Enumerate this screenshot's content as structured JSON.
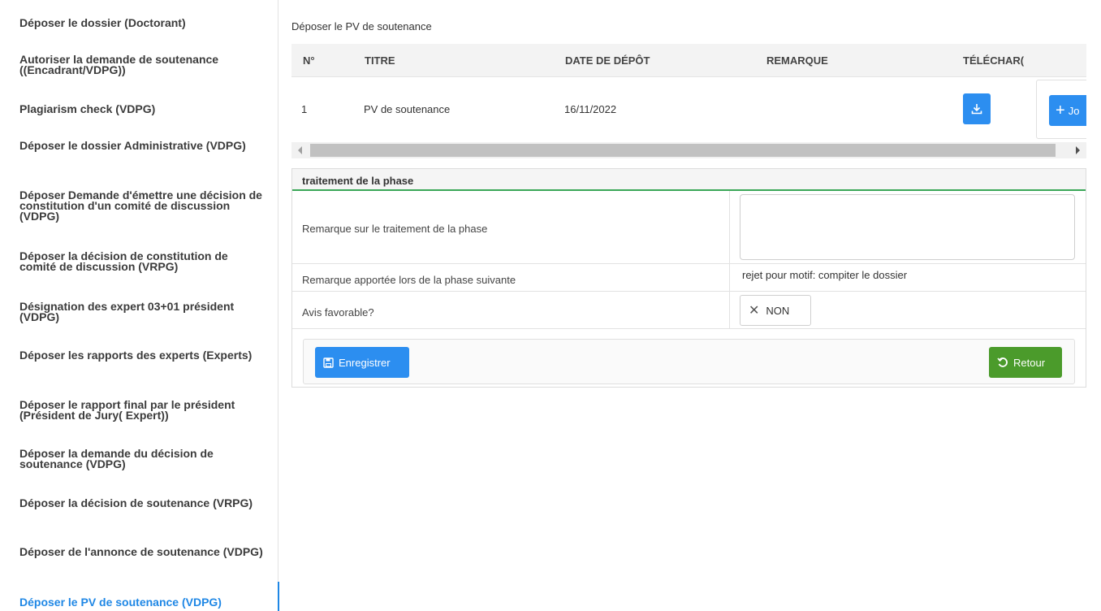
{
  "sidebar": {
    "items": [
      {
        "label": "Déposer le dossier (Doctorant)"
      },
      {
        "label": "Autoriser la demande de soutenance ((Encadrant/VDPG))"
      },
      {
        "label": "Plagiarism check (VDPG)"
      },
      {
        "label": "Déposer le dossier Administrative (VDPG)"
      },
      {
        "label": "Déposer Demande d'émettre une décision de constitution d'un comité de discussion (VDPG)"
      },
      {
        "label": "Déposer la décision de constitution de comité de discussion (VRPG)"
      },
      {
        "label": "Désignation des expert 03+01 président (VDPG)"
      },
      {
        "label": "Déposer les rapports des experts (Experts)"
      },
      {
        "label": "Déposer le rapport final par le président (Président de Jury( Expert))"
      },
      {
        "label": "Déposer la demande du décision de soutenance (VDPG)"
      },
      {
        "label": "Déposer la décision de soutenance (VRPG)"
      },
      {
        "label": "Déposer de l'annonce de soutenance (VDPG)"
      },
      {
        "label": "Déposer le PV de soutenance (VDPG)"
      }
    ],
    "active_index": 12
  },
  "main": {
    "title": "Déposer le PV de soutenance",
    "table": {
      "headers": [
        "N°",
        "TITRE",
        "DATE DE DÉPÔT",
        "REMARQUE",
        "TÉLÉCHAR("
      ],
      "rows": [
        {
          "num": "1",
          "titre": "PV de soutenance",
          "date": "16/11/2022",
          "remarque": ""
        }
      ],
      "join_label": "Jo"
    },
    "panel": {
      "title": "traitement de la phase",
      "row1_label": "Remarque sur le traitement de la phase",
      "row2_label": "Remarque apportée lors de la phase suivante",
      "row2_value": "rejet pour motif: compiter le dossier",
      "row3_label": "Avis favorable?",
      "toggle_label": "NON",
      "save_label": "Enregistrer",
      "back_label": "Retour"
    }
  },
  "colors": {
    "accent": "#1f87e5",
    "button_blue": "#2c8ef0",
    "button_green": "#4b9b2b",
    "panel_border": "#3aa757"
  }
}
